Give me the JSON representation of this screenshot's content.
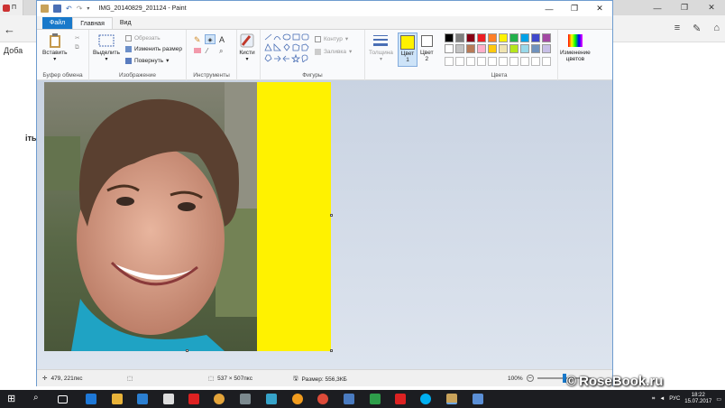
{
  "browser": {
    "tab_label": "П",
    "side_text_1": "Доба",
    "side_text_2": "іты",
    "win_minimize": "—",
    "win_maximize": "❐",
    "win_close": "✕",
    "back_icon": "←"
  },
  "paint": {
    "title": "IMG_20140829_201124 - Paint",
    "tabs": [
      "Файл",
      "Главная",
      "Вид"
    ],
    "ribbon": {
      "clipboard": {
        "paste": "Вставить",
        "group": "Буфер обмена"
      },
      "image": {
        "select": "Выделить",
        "crop": "Обрезать",
        "resize": "Изменить размер",
        "rotate": "Повернуть",
        "group": "Изображение"
      },
      "tools": {
        "group": "Инструменты"
      },
      "brushes": {
        "label": "Кисти"
      },
      "shapes": {
        "outline": "Контур",
        "fill": "Заливка",
        "group": "Фигуры"
      },
      "size": {
        "label": "Толщина"
      },
      "color1": {
        "label": "Цвет",
        "num": "1",
        "value": "#fff200"
      },
      "color2": {
        "label": "Цвет",
        "num": "2",
        "value": "#ffffff"
      },
      "colors": {
        "group": "Цвета",
        "edit_label_1": "Изменение",
        "edit_label_2": "цветов"
      }
    },
    "palette_row1": [
      "#000000",
      "#7f7f7f",
      "#880015",
      "#ed1c24",
      "#ff7f27",
      "#fff200",
      "#22b14c",
      "#00a2e8",
      "#3f48cc",
      "#a349a4"
    ],
    "palette_row2": [
      "#ffffff",
      "#c3c3c3",
      "#b97a57",
      "#ffaec9",
      "#ffc90e",
      "#efe4b0",
      "#b5e61d",
      "#99d9ea",
      "#7092be",
      "#c8bfe7"
    ],
    "status": {
      "cursor": "479, 221пкс",
      "size": "537 × 507пкс",
      "file_size": "Размер: 556,3КБ",
      "zoom": "100%",
      "zoom_level": 1.0
    }
  },
  "taskbar": {
    "lang": "РУС",
    "time": "18:22",
    "date": "15.07.2017"
  },
  "watermark": {
    "symbol": "©",
    "text": "RoseBook.ru"
  }
}
